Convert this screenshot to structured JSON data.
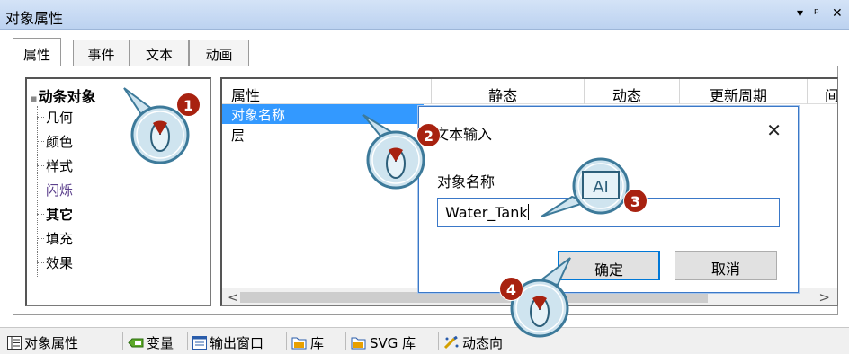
{
  "window": {
    "title": "对象属性",
    "ctrl_menu": "▾",
    "ctrl_pin": "ᵖ",
    "ctrl_close": "✕"
  },
  "tabs": [
    "属性",
    "事件",
    "文本",
    "动画"
  ],
  "tree": {
    "root_icon": "▪",
    "root": "动条对象",
    "items": [
      "几何",
      "颜色",
      "样式",
      "闪烁",
      "其它",
      "填充",
      "效果"
    ]
  },
  "grid": {
    "columns": [
      "属性",
      "静态",
      "动态",
      "更新周期",
      "间"
    ],
    "rows": [
      "对象名称",
      "层"
    ],
    "scroll_left": "<",
    "scroll_right": ">"
  },
  "dialog": {
    "title": "文本输入",
    "close": "✕",
    "label": "对象名称",
    "input_value": "Water_Tank",
    "ok": "确定",
    "cancel": "取消"
  },
  "callouts": {
    "text_cursor": "AI",
    "steps": [
      "1",
      "2",
      "3",
      "4"
    ]
  },
  "statusbar": [
    "对象属性",
    "变量",
    "输出窗口",
    "库",
    "SVG 库",
    "动态向"
  ]
}
